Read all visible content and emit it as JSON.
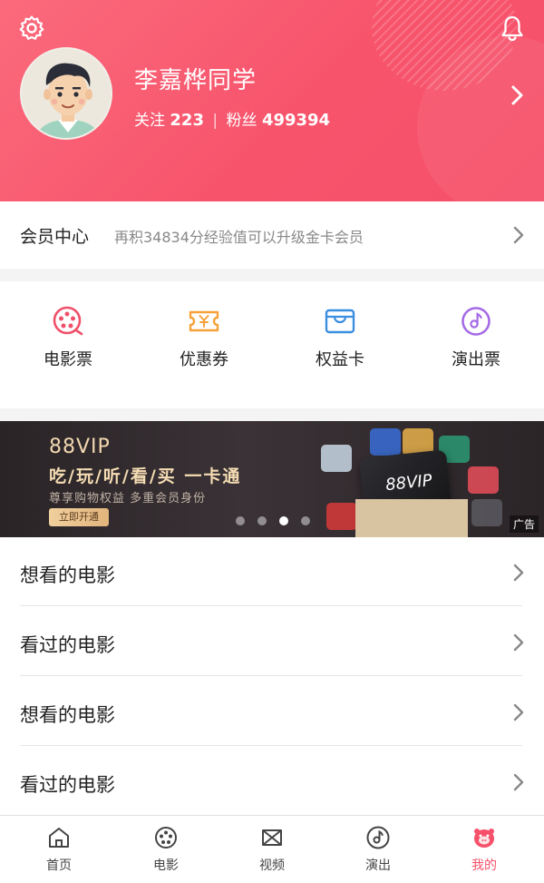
{
  "header": {
    "username": "李嘉桦同学",
    "follow_label": "关注",
    "follow_count": "223",
    "fans_label": "粉丝",
    "fans_count": "499394",
    "separator": "|",
    "icons": [
      "gear-icon",
      "bell-icon",
      "chevron-right-icon"
    ]
  },
  "member": {
    "title": "会员中心",
    "description": "再积34834分经验值可以升级金卡会员"
  },
  "quick_actions": [
    {
      "label": "电影票",
      "icon": "film-reel-icon",
      "color": "#f0506a"
    },
    {
      "label": "优惠券",
      "icon": "coupon-icon",
      "color": "#f6a13a"
    },
    {
      "label": "权益卡",
      "icon": "card-wallet-icon",
      "color": "#3a8fe0"
    },
    {
      "label": "演出票",
      "icon": "music-disc-icon",
      "color": "#a56be6"
    }
  ],
  "banner": {
    "brand": "88VIP",
    "slogan": "吃/玩/听/看/买  一卡通",
    "subtitle": "尊享购物权益  多重会员身份",
    "cta": "立即开通",
    "card_text": "88VIP",
    "ad_label": "广告",
    "page_count": 4,
    "active_page": 3
  },
  "list_items": [
    {
      "label": "想看的电影"
    },
    {
      "label": "看过的电影"
    },
    {
      "label": "想看的电影"
    },
    {
      "label": "看过的电影"
    }
  ],
  "tabbar": [
    {
      "label": "首页",
      "icon": "home-icon",
      "active": false
    },
    {
      "label": "电影",
      "icon": "film-icon",
      "active": false
    },
    {
      "label": "视频",
      "icon": "video-icon",
      "active": false
    },
    {
      "label": "演出",
      "icon": "disc-icon",
      "active": false
    },
    {
      "label": "我的",
      "icon": "mascot-icon",
      "active": true
    }
  ],
  "colors": {
    "brand": "#f6506a",
    "header_gradient_start": "#fb6a7c",
    "banner_gold": "#f2d8b0"
  }
}
